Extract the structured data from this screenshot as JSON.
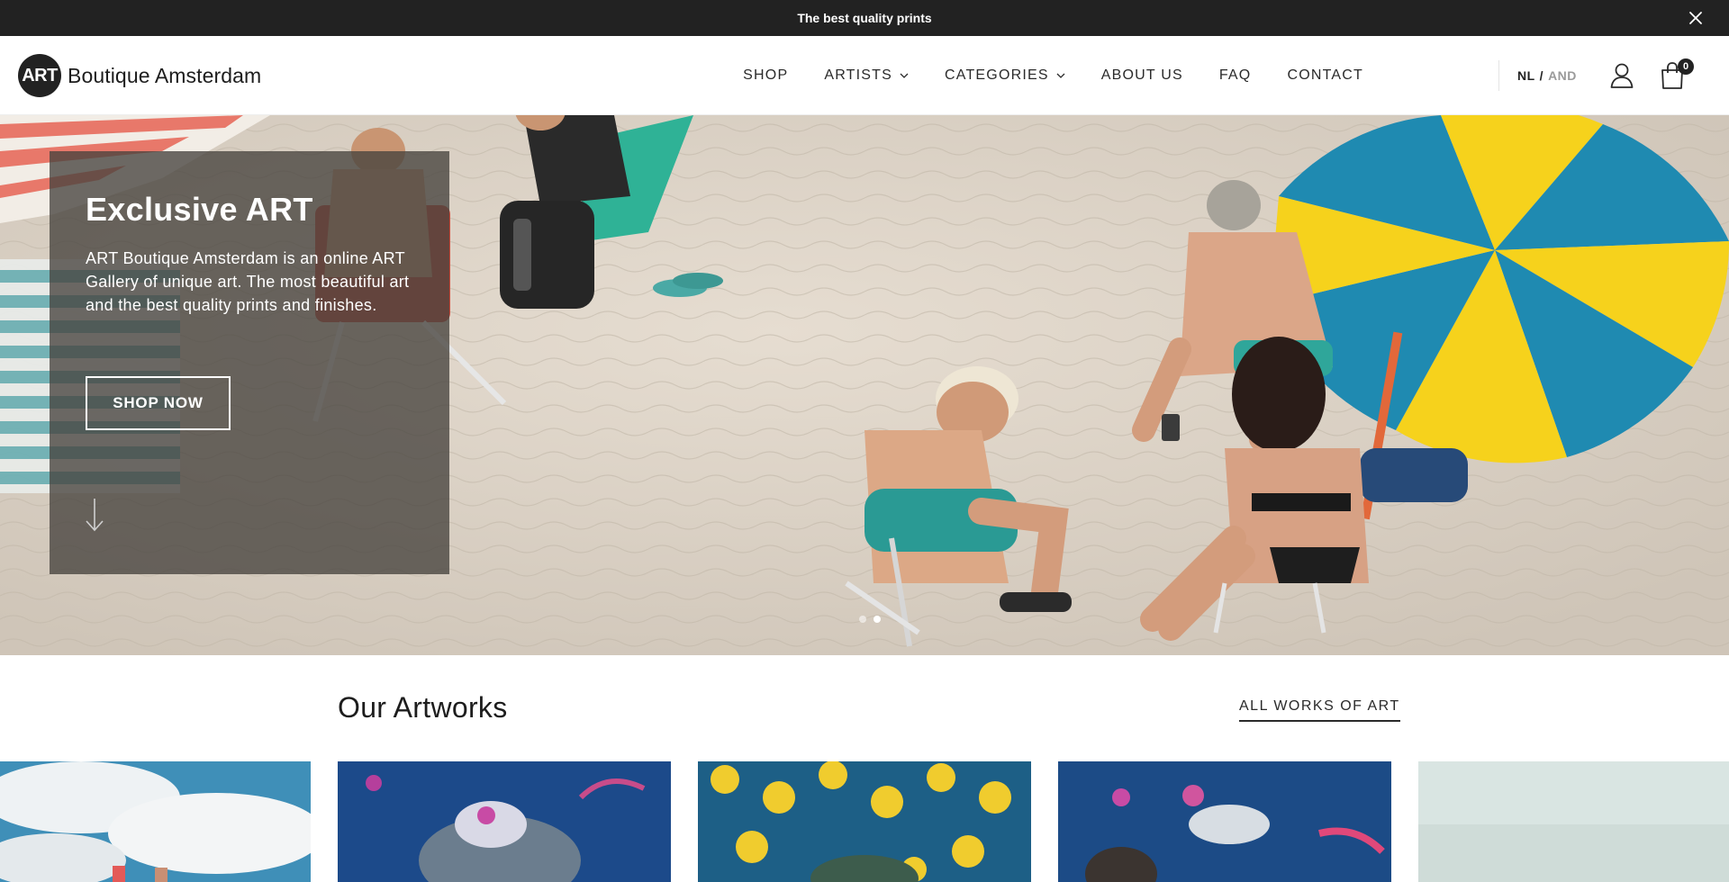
{
  "announcement": {
    "text": "The best quality prints",
    "close_icon": "close-icon"
  },
  "header": {
    "logo_mark": "ART",
    "logo_text": "Boutique Amsterdam",
    "nav": [
      {
        "label": "SHOP"
      },
      {
        "label": "ARTISTS",
        "has_dropdown": true
      },
      {
        "label": "CATEGORIES",
        "has_dropdown": true
      },
      {
        "label": "ABOUT US"
      },
      {
        "label": "FAQ"
      },
      {
        "label": "CONTACT"
      }
    ],
    "language": {
      "current": "NL",
      "separator": "/",
      "alternate": "AND"
    },
    "user_icon": "user-icon",
    "cart_icon": "shopping-bag-icon",
    "cart_count": "0"
  },
  "hero": {
    "title": "Exclusive ART",
    "text": "ART Boutique Amsterdam is an online ART Gallery of unique art. The most beautiful art and the best quality prints and finishes.",
    "button_label": "SHOP NOW",
    "scroll_icon": "arrow-down-icon",
    "slides": 2,
    "active_slide": 2
  },
  "artworks": {
    "title": "Our Artworks",
    "all_link": "ALL WORKS OF ART"
  },
  "colors": {
    "topbar": "#222222",
    "text": "#1d1d1d",
    "card_overlay": "#46423e",
    "sand": "#dcd3c7"
  }
}
